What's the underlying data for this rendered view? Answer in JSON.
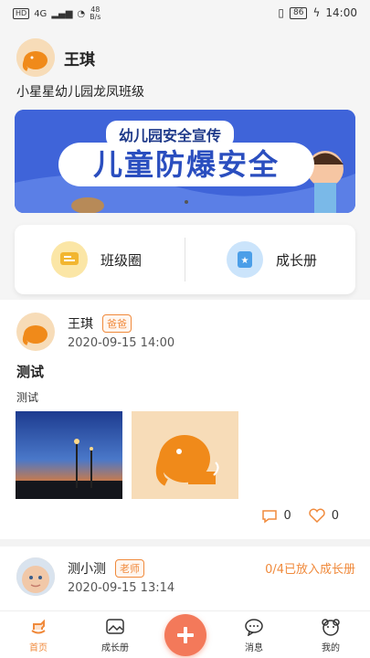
{
  "status_bar": {
    "signal": "4G",
    "net_speed_value": "48",
    "net_speed_unit": "B/s",
    "battery": "86",
    "time": "14:00"
  },
  "profile": {
    "name": "王琪",
    "class_name": "小星星幼儿园龙凤班级"
  },
  "banner": {
    "subtitle": "幼儿园安全宣传",
    "title": "儿童防爆安全"
  },
  "quick_actions": [
    {
      "label": "班级圈",
      "icon": "chat-bubble-icon",
      "color": "#f7c745"
    },
    {
      "label": "成长册",
      "icon": "album-icon",
      "color": "#5aa9ef"
    }
  ],
  "posts": [
    {
      "author": "王琪",
      "role": "爸爸",
      "time": "2020-09-15 14:00",
      "title": "测试",
      "body": "测试",
      "comments": "0",
      "likes": "0"
    },
    {
      "author": "测小测",
      "role": "老师",
      "time": "2020-09-15 13:14",
      "growth_status": "0/4已放入成长册"
    }
  ],
  "tabs": [
    {
      "label": "首页",
      "icon": "rocking-horse-icon",
      "active": true
    },
    {
      "label": "成长册",
      "icon": "picture-icon",
      "active": false
    },
    {
      "label": "消息",
      "icon": "message-icon",
      "active": false
    },
    {
      "label": "我的",
      "icon": "bear-face-icon",
      "active": false
    }
  ],
  "colors": {
    "accent": "#f08a3c",
    "fab": "#f3795a",
    "banner": "#3f64d9"
  }
}
